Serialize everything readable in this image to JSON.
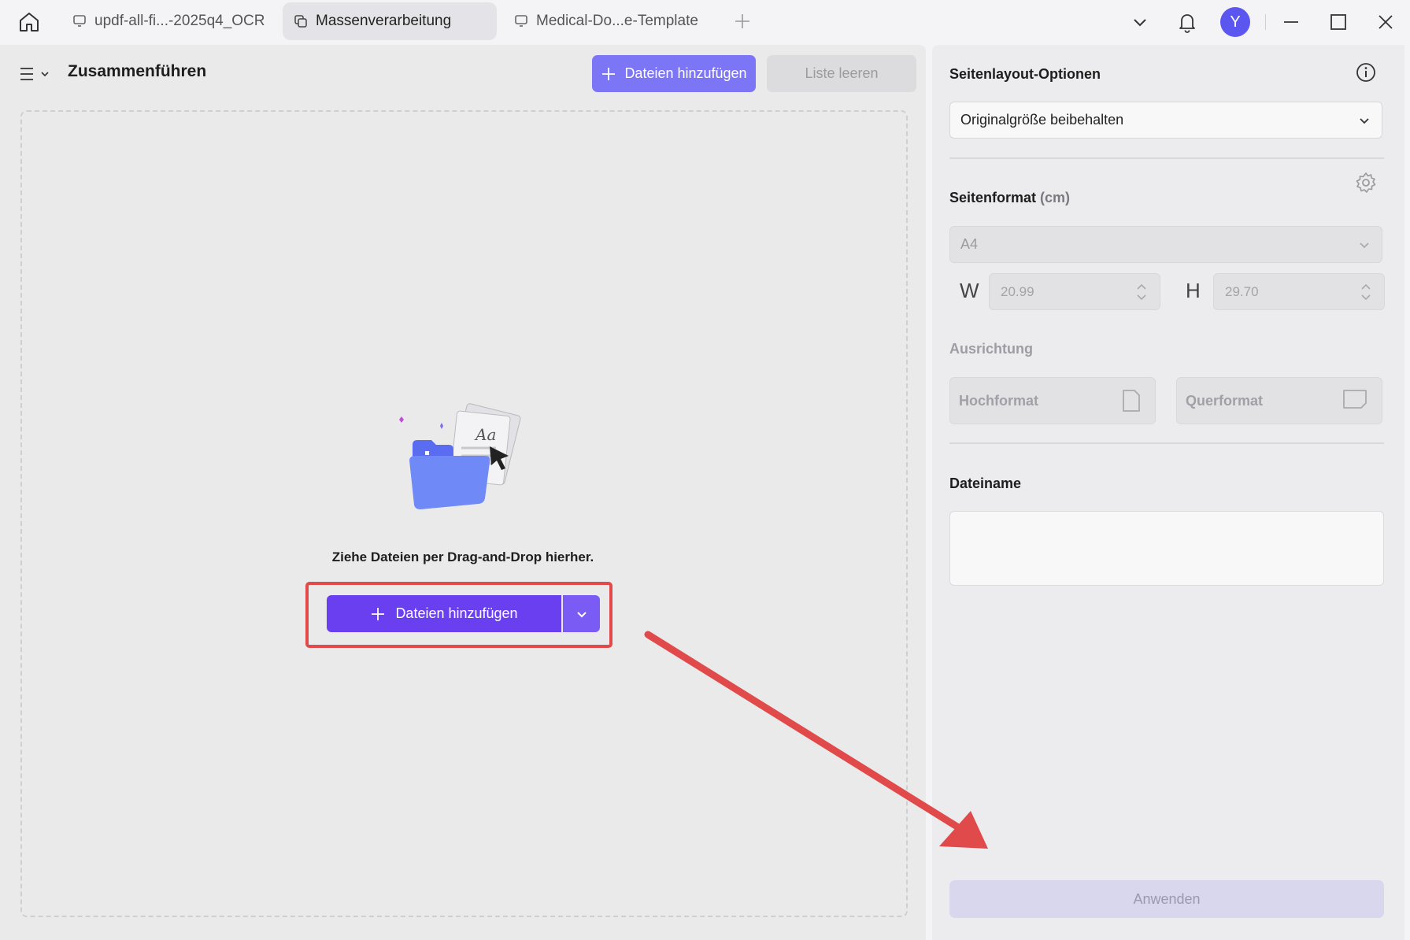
{
  "titlebar": {
    "tabs": [
      {
        "label": "updf-all-fi...-2025q4_OCR",
        "active": false
      },
      {
        "label": "Massenverarbeitung",
        "active": true
      },
      {
        "label": "Medical-Do...e-Template",
        "active": false
      }
    ],
    "avatar_letter": "Y"
  },
  "left": {
    "title": "Zusammenführen",
    "add_files_label": "Dateien hinzufügen",
    "clear_list_label": "Liste leeren",
    "drop_text": "Ziehe Dateien per Drag-and-Drop hierher.",
    "main_add_label": "Dateien hinzufügen",
    "illustration_text": "Aa"
  },
  "right": {
    "layout_title": "Seitenlayout-Optionen",
    "layout_value": "Originalgröße beibehalten",
    "format_title": "Seitenformat",
    "format_unit": "(cm)",
    "format_value": "A4",
    "width_label": "W",
    "width_value": "20.99",
    "height_label": "H",
    "height_value": "29.70",
    "orientation_title": "Ausrichtung",
    "portrait_label": "Hochformat",
    "landscape_label": "Querformat",
    "filename_title": "Dateiname",
    "filename_value": "",
    "apply_label": "Anwenden"
  },
  "colors": {
    "accent": "#6a3ff0",
    "accent_light": "#7c75f5",
    "annotation_red": "#e14a4a"
  },
  "icons": [
    "home-icon",
    "monitor-icon",
    "copy-icon",
    "plus-icon",
    "chevron-down-icon",
    "bell-icon",
    "minimize-icon",
    "maximize-icon",
    "close-icon",
    "menu-icon",
    "info-icon",
    "gear-icon",
    "portrait-page-icon",
    "landscape-page-icon",
    "folder-files-icon"
  ]
}
